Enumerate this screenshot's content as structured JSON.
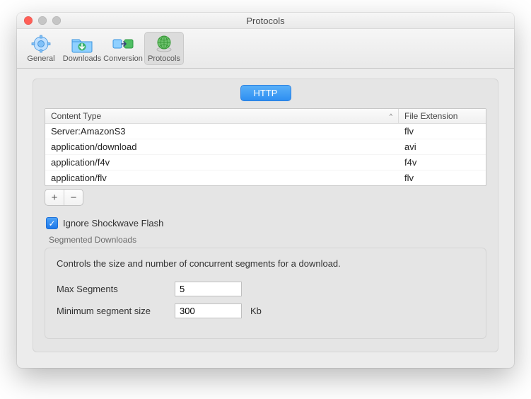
{
  "window": {
    "title": "Protocols"
  },
  "toolbar": {
    "items": [
      {
        "label": "General"
      },
      {
        "label": "Downloads"
      },
      {
        "label": "Conversion"
      },
      {
        "label": "Protocols"
      }
    ],
    "selected_index": 3
  },
  "tabs": {
    "active": "HTTP"
  },
  "table": {
    "columns": {
      "content_type": "Content Type",
      "file_extension": "File Extension"
    },
    "sort_indicator": "^",
    "rows": [
      {
        "type": "Server:AmazonS3",
        "ext": "flv"
      },
      {
        "type": "application/download",
        "ext": "avi"
      },
      {
        "type": "application/f4v",
        "ext": "f4v"
      },
      {
        "type": "application/flv",
        "ext": "flv"
      }
    ]
  },
  "buttons": {
    "add": "+",
    "remove": "−"
  },
  "checkbox": {
    "ignore_shockwave": "Ignore Shockwave Flash",
    "check_glyph": "✓"
  },
  "segmented": {
    "title": "Segmented Downloads",
    "desc": "Controls the size and number of concurrent segments for a download.",
    "max_segments_label": "Max Segments",
    "max_segments_value": "5",
    "min_size_label": "Minimum segment size",
    "min_size_value": "300",
    "min_size_unit": "Kb"
  }
}
